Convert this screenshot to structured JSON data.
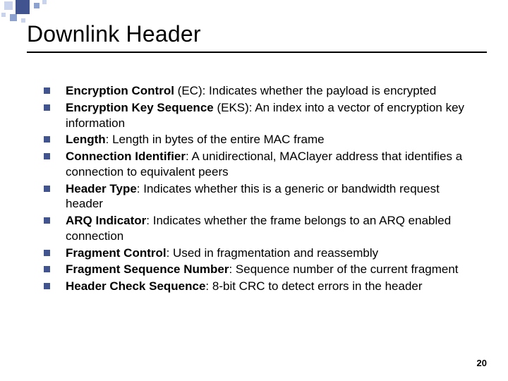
{
  "title": "Downlink Header",
  "page_number": "20",
  "bullets": [
    {
      "term": "Encryption Control",
      "suffix": " (EC): Indicates whether the payload is encrypted"
    },
    {
      "term": "Encryption Key Sequence",
      "suffix": " (EKS): An index into a vector of encryption key information"
    },
    {
      "term": "Length",
      "suffix": ": Length in bytes of the entire MAC frame"
    },
    {
      "term": "Connection Identifier",
      "suffix": ": A unidirectional, MAClayer address that identifies a connection to equivalent peers"
    },
    {
      "term": "Header Type",
      "suffix": ": Indicates whether this is a generic or bandwidth request header"
    },
    {
      "term": "ARQ Indicator",
      "suffix": ": Indicates whether the frame belongs to an ARQ enabled connection"
    },
    {
      "term": "Fragment Control",
      "suffix": ": Used in fragmentation and reassembly"
    },
    {
      "term": "Fragment Sequence Number",
      "suffix": ": Sequence number of the current fragment"
    },
    {
      "term": "Header Check Sequence",
      "suffix": ": 8-bit CRC to detect errors in the header"
    }
  ]
}
